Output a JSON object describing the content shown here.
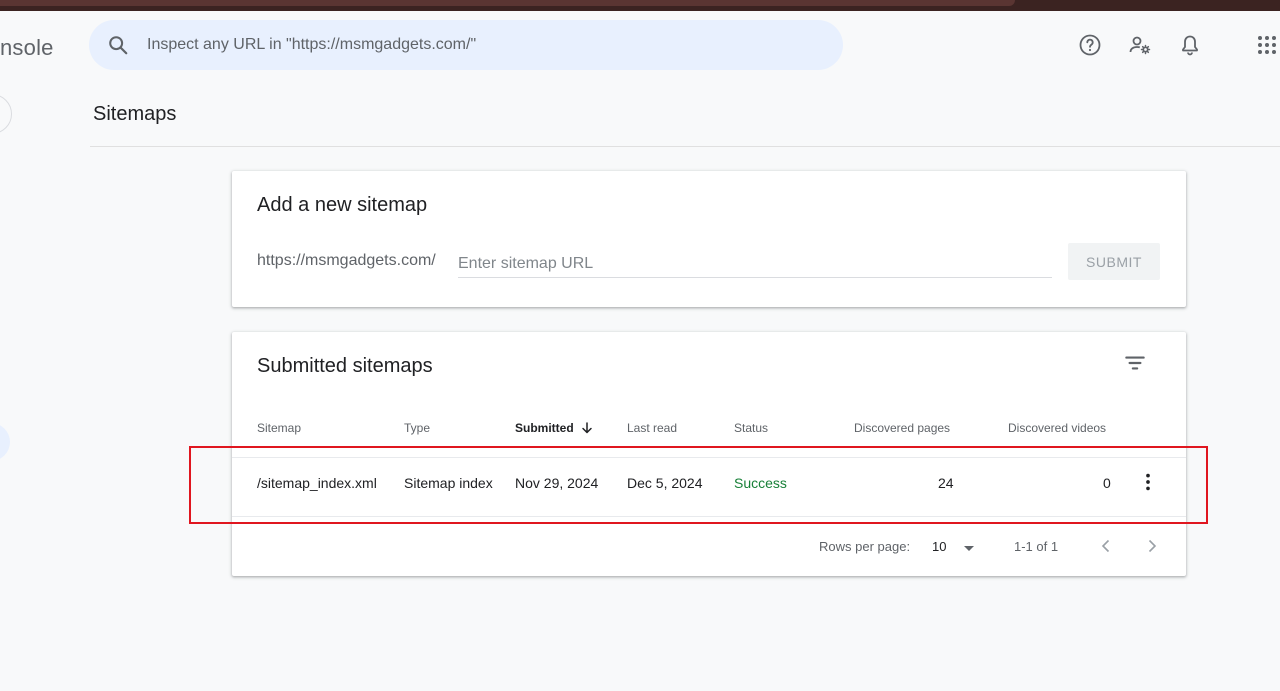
{
  "header": {
    "brand": "nsole",
    "search_placeholder": "Inspect any URL in \"https://msmgadgets.com/\"",
    "icons": [
      "help-icon",
      "admin-settings-icon",
      "notifications-icon",
      "apps-icon"
    ]
  },
  "page": {
    "title": "Sitemaps"
  },
  "add_sitemap": {
    "title": "Add a new sitemap",
    "url_prefix": "https://msmgadgets.com/",
    "input_placeholder": "Enter sitemap URL",
    "submit_label": "SUBMIT"
  },
  "submitted": {
    "title": "Submitted sitemaps",
    "columns": {
      "sitemap": "Sitemap",
      "type": "Type",
      "submitted": "Submitted",
      "last_read": "Last read",
      "status": "Status",
      "discovered_pages": "Discovered pages",
      "discovered_videos": "Discovered videos"
    },
    "rows": [
      {
        "sitemap": "/sitemap_index.xml",
        "type": "Sitemap index",
        "submitted": "Nov 29, 2024",
        "last_read": "Dec 5, 2024",
        "status": "Success",
        "discovered_pages": "24",
        "discovered_videos": "0"
      }
    ],
    "footer": {
      "rows_per_page_label": "Rows per page:",
      "rows_per_page_value": "10",
      "range": "1-1 of 1"
    }
  },
  "colors": {
    "accent": "#1a73e8",
    "success": "#188038",
    "highlight": "#e0161f"
  }
}
